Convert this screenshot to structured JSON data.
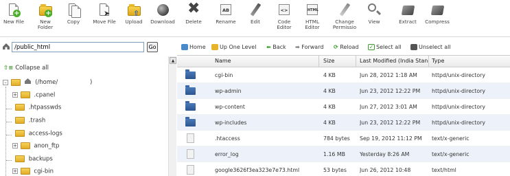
{
  "toolbar": {
    "buttons": [
      {
        "label": "New File",
        "icon": "new-file-icon"
      },
      {
        "label": "New\nFolder",
        "icon": "new-folder-icon"
      },
      {
        "label": "Copy",
        "icon": "copy-icon"
      },
      {
        "label": "Move File",
        "icon": "move-file-icon"
      },
      {
        "label": "Upload",
        "icon": "upload-icon"
      },
      {
        "label": "Download",
        "icon": "download-icon"
      },
      {
        "label": "Delete",
        "icon": "delete-icon"
      },
      {
        "label": "Rename",
        "icon": "rename-icon"
      },
      {
        "label": "Edit",
        "icon": "edit-icon"
      },
      {
        "label": "Code\nEditor",
        "icon": "code-editor-icon"
      },
      {
        "label": "HTML\nEditor",
        "icon": "html-editor-icon"
      },
      {
        "label": "Change\nPermissio",
        "icon": "change-permissions-icon"
      },
      {
        "label": "View",
        "icon": "view-icon"
      },
      {
        "label": "Extract",
        "icon": "extract-icon"
      },
      {
        "label": "Compress",
        "icon": "compress-icon"
      }
    ]
  },
  "path": {
    "value": "/public_html",
    "go_label": "Go"
  },
  "tree": {
    "collapse_label": "Collapse all",
    "root_label": "(/home/",
    "root_suffix": ")",
    "items": [
      ".cpanel",
      ".htpasswds",
      ".trash",
      "access-logs",
      "anon_ftp",
      "backups",
      "cgi-bin"
    ]
  },
  "nav": {
    "home": "Home",
    "up": "Up One Level",
    "back": "Back",
    "forward": "Forward",
    "reload": "Reload",
    "select_all": "Select all",
    "unselect_all": "Unselect all"
  },
  "table": {
    "headers": {
      "name": "Name",
      "size": "Size",
      "modified": "Last Modified (India Stanc",
      "type": "Type"
    },
    "rows": [
      {
        "kind": "folder",
        "name": "cgi-bin",
        "size": "4 KB",
        "modified": "Jun 28, 2012 1:18 AM",
        "type": "httpd/unix-directory"
      },
      {
        "kind": "folder",
        "name": "wp-admin",
        "size": "4 KB",
        "modified": "Jun 23, 2012 12:22 PM",
        "type": "httpd/unix-directory"
      },
      {
        "kind": "folder",
        "name": "wp-content",
        "size": "4 KB",
        "modified": "Jun 27, 2012 3:01 AM",
        "type": "httpd/unix-directory"
      },
      {
        "kind": "folder",
        "name": "wp-includes",
        "size": "4 KB",
        "modified": "Jun 23, 2012 12:22 PM",
        "type": "httpd/unix-directory"
      },
      {
        "kind": "file",
        "name": ".htaccess",
        "size": "784 bytes",
        "modified": "Sep 19, 2012 11:12 PM",
        "type": "text/x-generic"
      },
      {
        "kind": "file",
        "name": "error_log",
        "size": "1.16 MB",
        "modified": "Yesterday 8:26 AM",
        "type": "text/x-generic"
      },
      {
        "kind": "file",
        "name": "google3626f3ea323e7e73.html",
        "size": "53 bytes",
        "modified": "Jun 26, 2012 10:48",
        "type": "text/html"
      }
    ]
  },
  "colors": {
    "folder_blue": "#2c5590",
    "row_alt": "#edf2fa",
    "select_green": "#4caf2b"
  }
}
